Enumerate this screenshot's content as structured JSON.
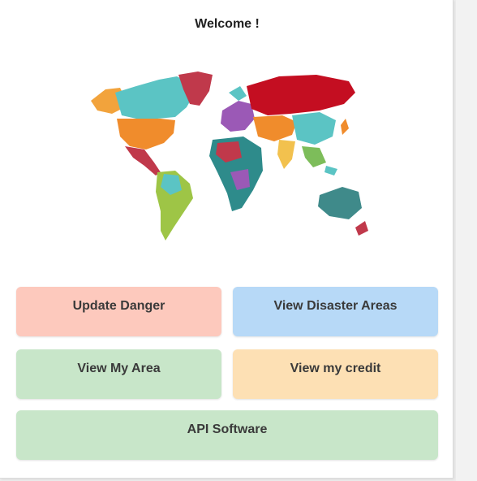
{
  "header": {
    "title": "Welcome !"
  },
  "map": {
    "icon": "world-map"
  },
  "buttons": {
    "update_danger": {
      "label": "Update Danger",
      "color": "#fdc9bd"
    },
    "view_disaster_areas": {
      "label": "View Disaster Areas",
      "color": "#b7d9f7"
    },
    "view_my_area": {
      "label": "View My Area",
      "color": "#c8e6c9"
    },
    "view_my_credit": {
      "label": "View my credit",
      "color": "#fde0b4"
    },
    "api_software": {
      "label": "API Software",
      "color": "#c8e6c9"
    }
  }
}
